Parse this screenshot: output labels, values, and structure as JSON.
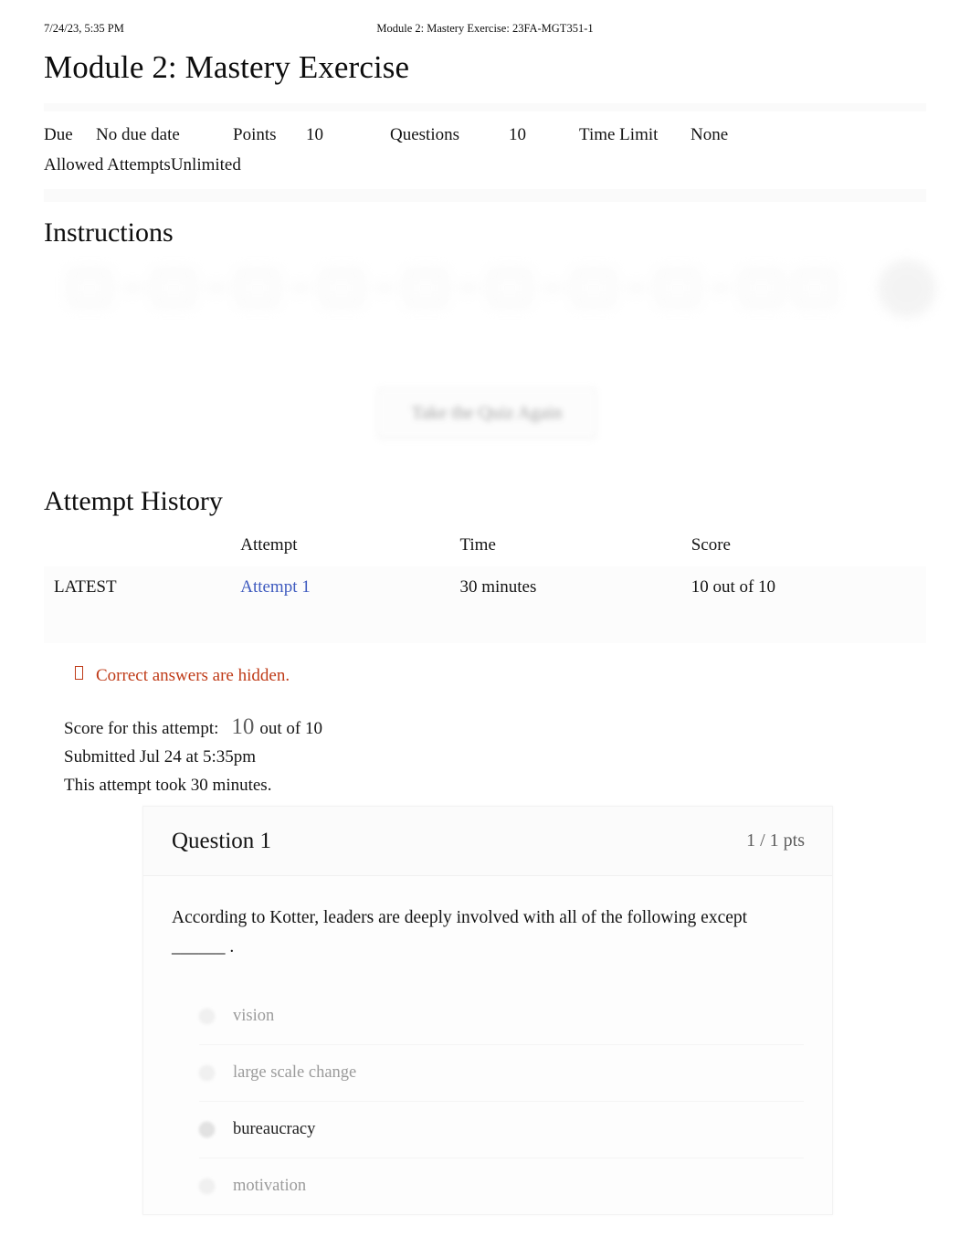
{
  "print_header": {
    "date": "7/24/23, 5:35 PM",
    "title": "Module 2: Mastery Exercise: 23FA-MGT351-1"
  },
  "page": {
    "title": "Module 2: Mastery Exercise"
  },
  "quiz_meta": {
    "due_label": "Due",
    "due_value": "No due date",
    "points_label": "Points",
    "points_value": "10",
    "questions_label": "Questions",
    "questions_value": "10",
    "time_limit_label": "Time Limit",
    "time_limit_value": "None",
    "allowed_attempts_label": "Allowed Attempts",
    "allowed_attempts_value": "Unlimited"
  },
  "instructions": {
    "heading": "Instructions"
  },
  "retake": {
    "label": "Take the Quiz Again"
  },
  "attempt_history": {
    "heading": "Attempt History",
    "columns": [
      "",
      "Attempt",
      "Time",
      "Score"
    ],
    "rows": [
      {
        "label": "LATEST",
        "attempt": "Attempt 1",
        "time": "30 minutes",
        "score": "10 out of 10"
      }
    ]
  },
  "notice": {
    "icon": "warning-icon",
    "text": "Correct answers are hidden."
  },
  "attempt_summary": {
    "score_label": "Score for this attempt:",
    "score_value": "10",
    "score_suffix": "out of 10",
    "submitted": "Submitted Jul 24 at 5:35pm",
    "duration": "This attempt took 30 minutes."
  },
  "question": {
    "title": "Question 1",
    "points": "1 / 1 pts",
    "text": "According to Kotter, leaders are deeply involved with all of the following except ______ .",
    "answers": [
      {
        "label": "vision",
        "selected": false
      },
      {
        "label": "large scale change",
        "selected": false
      },
      {
        "label": "bureaucracy",
        "selected": true
      },
      {
        "label": "motivation",
        "selected": false
      }
    ]
  },
  "colors": {
    "link": "#3f5bbf",
    "warning": "#bf3b18",
    "muted": "#9b9b9b",
    "text": "#141414",
    "card_header_bg": "#fbfbfb"
  }
}
